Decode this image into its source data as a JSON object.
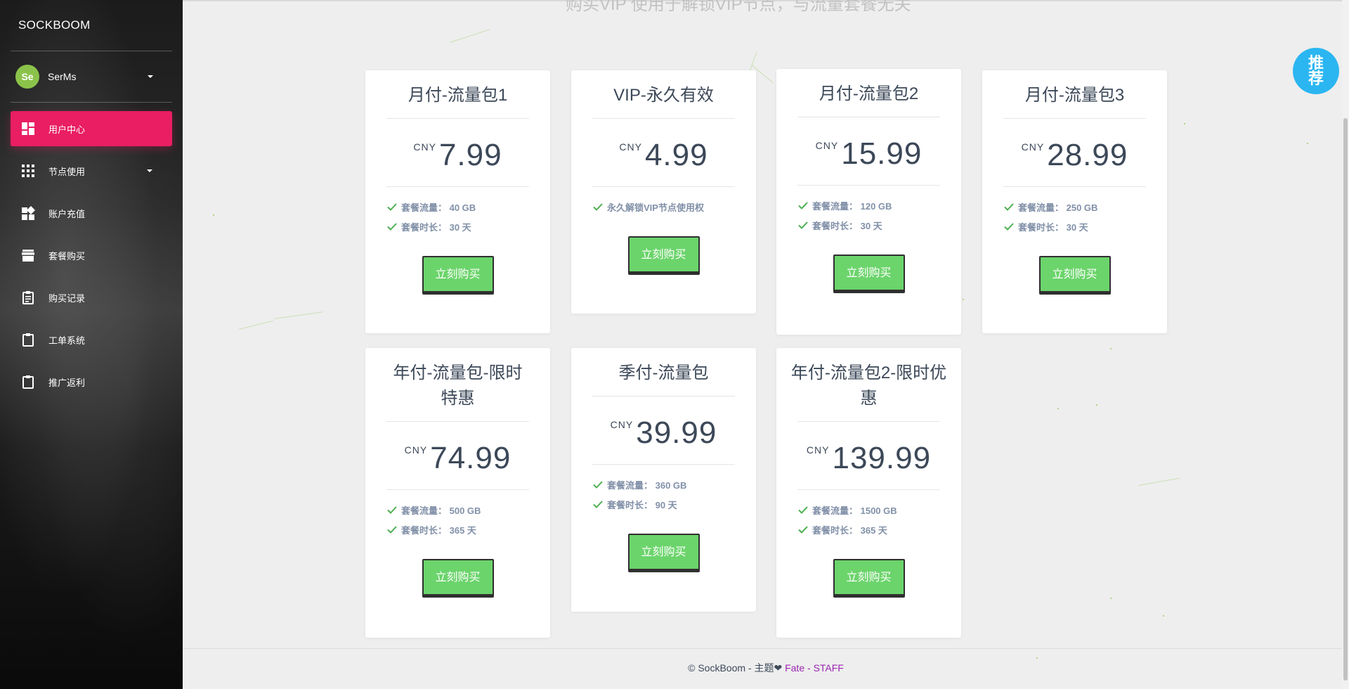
{
  "sidebar": {
    "brand": "SOCKBOOM",
    "user": {
      "initials": "Se",
      "name": "SerMs"
    },
    "items": [
      {
        "label": "用户中心",
        "icon": "dashboard-icon",
        "active": true
      },
      {
        "label": "节点使用",
        "icon": "apps-grid-icon",
        "dropdown": true
      },
      {
        "label": "账户充值",
        "icon": "widgets-icon"
      },
      {
        "label": "套餐购买",
        "icon": "store-icon"
      },
      {
        "label": "购买记录",
        "icon": "assignment-icon"
      },
      {
        "label": "工单系统",
        "icon": "clipboard-icon"
      },
      {
        "label": "推广返利",
        "icon": "clipboard-icon"
      }
    ]
  },
  "header": {
    "subtitle": "购买VIP 使用于解锁VIP节点，与流量套餐无关"
  },
  "badge": {
    "line1": "推",
    "line2": "荐"
  },
  "plans": [
    {
      "title": "月付-流量包1",
      "currency": "CNY",
      "price": "7.99",
      "features": [
        "套餐流量：  40 GB",
        "套餐时长：  30 天"
      ],
      "button": "立刻购买"
    },
    {
      "title": "VIP-永久有效",
      "currency": "CNY",
      "price": "4.99",
      "features": [
        "永久解锁VIP节点使用权"
      ],
      "button": "立刻购买"
    },
    {
      "title": "月付-流量包2",
      "currency": "CNY",
      "price": "15.99",
      "features": [
        "套餐流量：  120 GB",
        "套餐时长：  30 天"
      ],
      "button": "立刻购买"
    },
    {
      "title": "月付-流量包3",
      "currency": "CNY",
      "price": "28.99",
      "features": [
        "套餐流量：  250 GB",
        "套餐时长：  30 天"
      ],
      "button": "立刻购买"
    },
    {
      "title": "年付-流量包-限时特惠",
      "currency": "CNY",
      "price": "74.99",
      "features": [
        "套餐流量：  500 GB",
        "套餐时长：  365 天"
      ],
      "button": "立刻购买"
    },
    {
      "title": "季付-流量包",
      "currency": "CNY",
      "price": "39.99",
      "features": [
        "套餐流量：  360 GB",
        "套餐时长：  90 天"
      ],
      "button": "立刻购买"
    },
    {
      "title": "年付-流量包2-限时优惠",
      "currency": "CNY",
      "price": "139.99",
      "features": [
        "套餐流量：  1500 GB",
        "套餐时长：  365 天"
      ],
      "button": "立刻购买"
    }
  ],
  "footer": {
    "copyright": "© SockBoom - 主题",
    "heart": "❤",
    "link1": "Fate",
    "sep": " - ",
    "link2": "STAFF"
  },
  "colors": {
    "accent": "#e91e63",
    "button": "#6bd46b",
    "badge": "#2bb6f1",
    "avatar": "#8bc34a",
    "link": "#9c27b0"
  }
}
